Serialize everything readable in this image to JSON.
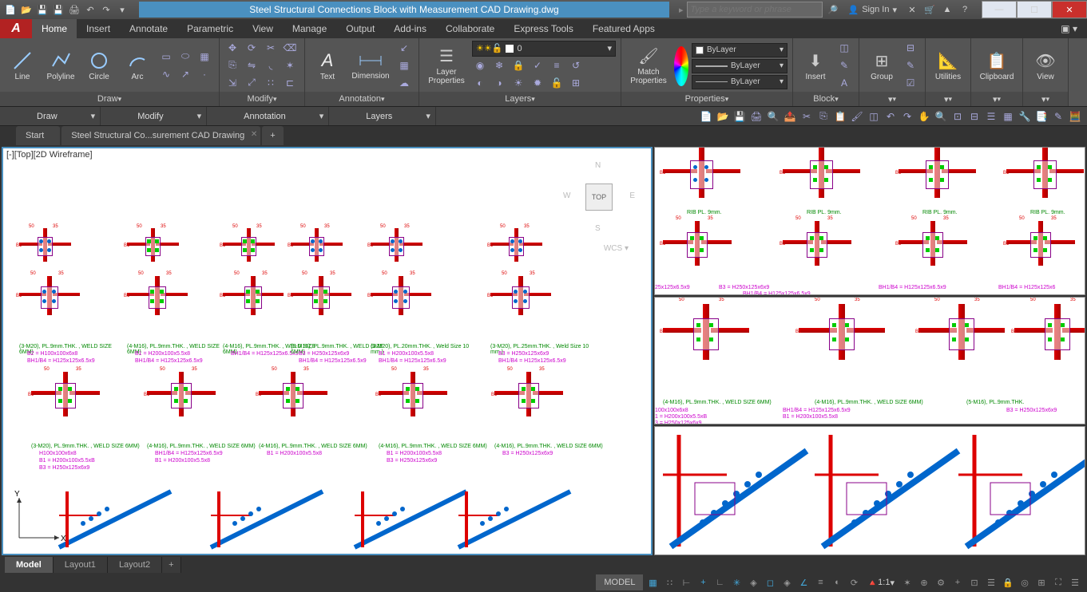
{
  "title": "Steel Structural Connections Block with Measurement CAD Drawing.dwg",
  "search": {
    "placeholder": "Type a keyword or phrase"
  },
  "sign_in": "Sign In",
  "menutabs": [
    "Home",
    "Insert",
    "Annotate",
    "Parametric",
    "View",
    "Manage",
    "Output",
    "Add-ins",
    "Collaborate",
    "Express Tools",
    "Featured Apps"
  ],
  "ribbon": {
    "draw": {
      "title": "Draw",
      "line": "Line",
      "polyline": "Polyline",
      "circle": "Circle",
      "arc": "Arc"
    },
    "modify": {
      "title": "Modify"
    },
    "annotation": {
      "title": "Annotation",
      "text": "Text",
      "dimension": "Dimension"
    },
    "layers": {
      "title": "Layers",
      "properties": "Layer\nProperties",
      "current": "0"
    },
    "block": {
      "title": "Block",
      "insert": "Insert"
    },
    "properties": {
      "title": "Properties",
      "match": "Match\nProperties",
      "layer": "ByLayer",
      "ltype": "ByLayer",
      "lweight": "ByLayer"
    },
    "groups": {
      "title": "Group"
    },
    "utilities": {
      "title": "Utilities"
    },
    "clipboard": {
      "title": "Clipboard"
    },
    "view": {
      "title": "View"
    }
  },
  "filetabs": {
    "start": "Start",
    "file": "Steel Structural Co...surement CAD Drawing"
  },
  "viewport": {
    "label": "[-][Top][2D Wireframe]",
    "cube": "TOP",
    "wcs": "WCS"
  },
  "drawing_notes": {
    "row1": [
      "(3-M20), PL.9mm.THK. , WELD SIZE 6MM)",
      "(4-M16), PL.9mm.THK. , WELD SIZE 6MM)",
      "(4-M16), PL.9mm.THK. , WELD SIZE 6MM)",
      "(8-M16), PL.9mm.THK. , WELD SIZE 6MM)",
      "(3-M20), PL.20mm.THK. , Weld Size 10 mm.)",
      "(3-M20), PL.25mm.THK. , Weld Size 10 mm.)"
    ],
    "specs1": [
      [
        "B2 = H100x100x6x8",
        "BH1/B4 = H125x125x6.5x9"
      ],
      [
        "B1 = H200x100x5.5x8",
        "BH1/B4 = H125x125x6.5x9"
      ],
      [
        "BH1/B4 = H125x125x6.5x9"
      ],
      [
        "B3 = H250x125x6x9",
        "BH1/B4 = H125x125x6.5x9"
      ],
      [
        "B1 = H200x100x5.5x8",
        "BH1/B4 = H125x125x6.5x9"
      ],
      [
        "B3 = H250x125x6x9",
        "BH1/B4 = H125x125x6.5x9"
      ]
    ],
    "row2": [
      "(3-M20), PL.9mm.THK. , WELD SIZE 6MM)",
      "(4-M16), PL.9mm.THK. , WELD SIZE 6MM)",
      "(4-M16), PL.9mm.THK. , WELD SIZE 6MM)",
      "(4-M16), PL.9mm.THK. , WELD SIZE 6MM)",
      "(4-M16), PL.9mm.THK. , WELD SIZE 6MM)"
    ],
    "specs2": [
      [
        "H100x100x6x8",
        "B1 = H200x100x5.5xB",
        "B3 = H250x125x6x9"
      ],
      [
        "BH1/B4 = H125x125x6.5x9",
        "B1 = H200x100x5.5x8"
      ],
      [
        "B1 = H200x100x5.5x8"
      ],
      [
        "B1 = H200x100x5.5x8",
        "B3 = H250x125x6x9"
      ],
      [
        "B3 = H250x125x6x9"
      ]
    ],
    "rib": "RIB PL. 9mm.",
    "right_top": [
      "25x125x6.5x9",
      "B3 = H250x125x6x9",
      "BH1/B4 = H125x125x6.5x9",
      "BH1/B4 = H125x125x6.5x9",
      "BH1/B4 = H125x125x6"
    ],
    "right_mid": [
      "100x100x6x8",
      "1 = H200x100x5.5xB",
      "3 = H250x125x6x9",
      "BH1/B4 = H125x125x6.5x9",
      "B1 = H200x100x5.5x8",
      "(4-M16), PL.9mm.THK. , WELD SIZE 6MM)",
      "(4-M16), PL.9mm.THK. , WELD SIZE 6MM)",
      "(5-M16), PL.9mm.THK.",
      "B3 = H250x125x6x9"
    ]
  },
  "bottom_tabs": {
    "model": "Model",
    "l1": "Layout1",
    "l2": "Layout2"
  },
  "status": {
    "model": "MODEL",
    "scale": "1:1"
  }
}
